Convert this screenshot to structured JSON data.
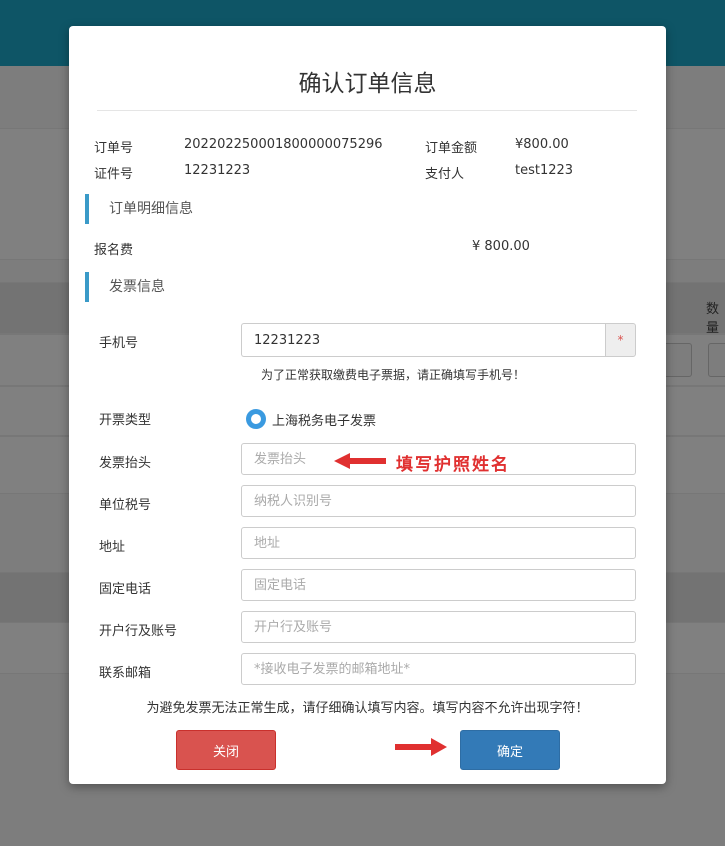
{
  "modal": {
    "title": "确认订单信息",
    "order": {
      "order_no_label": "订单号",
      "order_no_value": "202202250001800000075296",
      "amount_label": "订单金额",
      "amount_value": "¥800.00",
      "id_label": "证件号",
      "id_value": "12231223",
      "payer_label": "支付人",
      "payer_value": "test1223"
    },
    "detail_section": "订单明细信息",
    "detail_items": [
      {
        "name": "报名费",
        "price": "¥ 800.00"
      }
    ],
    "invoice_section": "发票信息",
    "form": {
      "phone_label": "手机号",
      "phone_value": "12231223",
      "phone_required": "*",
      "phone_hint": "为了正常获取缴费电子票据，请正确填写手机号！",
      "invoice_type_label": "开票类型",
      "invoice_type_option": "上海税务电子发票",
      "invoice_title_label": "发票抬头",
      "invoice_title_placeholder": "发票抬头",
      "tax_no_label": "单位税号",
      "tax_no_placeholder": "纳税人识别号",
      "address_label": "地址",
      "address_placeholder": "地址",
      "phone_fixed_label": "固定电话",
      "phone_fixed_placeholder": "固定电话",
      "bank_label": "开户行及账号",
      "bank_placeholder": "开户行及账号",
      "email_label": "联系邮箱",
      "email_placeholder": "*接收电子发票的邮箱地址*"
    },
    "annotation": "填写护照姓名",
    "notice": "为避免发票无法正常生成，请仔细确认填写内容。填写内容不允许出现字符！",
    "buttons": {
      "close": "关闭",
      "confirm": "确定"
    }
  },
  "background": {
    "column_label": "数量"
  },
  "colors": {
    "accent": "#3a9ac8",
    "danger": "#d9534f",
    "primary": "#337ab7",
    "annotation": "#e03030"
  }
}
